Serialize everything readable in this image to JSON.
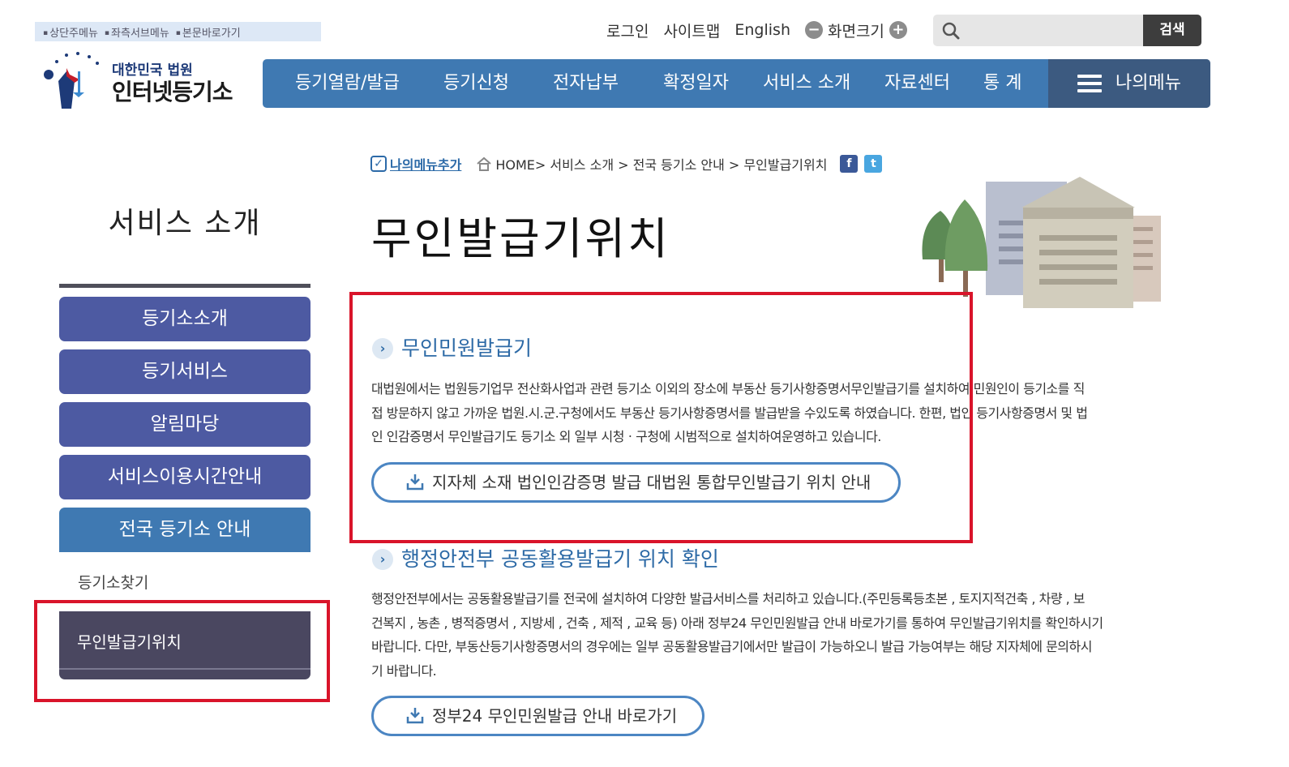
{
  "skip_links": [
    "상단주메뉴",
    "좌측서브메뉴",
    "본문바로가기"
  ],
  "util": {
    "login": "로그인",
    "sitemap": "사이트맵",
    "english": "English",
    "screen_size": "화면크기"
  },
  "search": {
    "button": "검색",
    "placeholder": ""
  },
  "logo": {
    "sub": "대한민국 법원",
    "main": "인터넷등기소"
  },
  "gnb": {
    "items": [
      "등기열람/발급",
      "등기신청",
      "전자납부",
      "확정일자",
      "서비스 소개",
      "자료센터",
      "통 계"
    ],
    "my_menu": "나의메뉴"
  },
  "lnb": {
    "title": "서비스 소개",
    "items": [
      "등기소소개",
      "등기서비스",
      "알림마당",
      "서비스이용시간안내",
      "전국 등기소 안내"
    ],
    "sub_items": [
      "등기소찾기",
      "무인발급기위치"
    ]
  },
  "breadcrumb": {
    "add_my_menu": "나의메뉴추가",
    "path": "HOME> 서비스 소개 > 전국 등기소 안내 > 무인발급기위치"
  },
  "page_title": "무인발급기위치",
  "sections": [
    {
      "title": "무인민원발급기",
      "body_lines": [
        "대법원에서는 법원등기업무 전산화사업과 관련 등기소 이외의 장소에 부동산 등기사항증명서무인발급기를 설치하여 민원인이 등기소를 직",
        "접 방문하지 않고 가까운 법원.시.군.구청에서도 부동산 등기사항증명서를 발급받을 수있도록 하였습니다. 한편, 법인 등기사항증명서 및 법",
        "인 인감증명서 무인발급기도 등기소 외 일부 시청ㆍ구청에 시범적으로 설치하여운영하고 있습니다."
      ],
      "button": "지자체 소재 법인인감증명 발급 대법원 통합무인발급기 위치 안내"
    },
    {
      "title": "행정안전부 공동활용발급기 위치 확인",
      "body_lines": [
        "행정안전부에서는 공동활용발급기를 전국에 설치하여 다양한 발급서비스를 처리하고 있습니다.(주민등록등초본 , 토지지적건축 , 차량 , 보",
        "건복지 , 농촌 , 병적증명서 , 지방세 , 건축 , 제적 , 교육 등) 아래 정부24 무인민원발급 안내 바로가기를 통하여 무인발급기위치를 확인하시기",
        "바랍니다. 다만, 부동산등기사항증명서의 경우에는 일부 공동활용발급기에서만 발급이 가능하오니 발급 가능여부는 해당 지자체에 문의하시",
        "기 바랍니다."
      ],
      "button": "정부24 무인민원발급 안내 바로가기"
    }
  ],
  "colors": {
    "gnb": "#3f79b2",
    "lnb": "#4d5aa2",
    "highlight": "#d9142a",
    "accent_text": "#2d6aa6"
  }
}
